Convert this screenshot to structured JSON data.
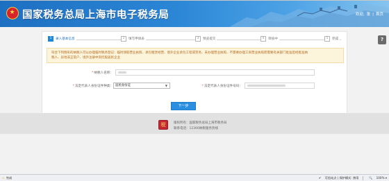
{
  "header": {
    "title": "国家税务总局上海市电子税务局",
    "welcome": "欢迎,",
    "username": "张",
    "separator": "|",
    "home_link": "首页"
  },
  "steps": [
    {
      "num": "1",
      "label": "录入基本信息",
      "active": true
    },
    {
      "num": "2",
      "label": "填写申请表",
      "active": false
    },
    {
      "num": "3",
      "label": "预览提交",
      "active": false
    },
    {
      "num": "4",
      "label": "审核中",
      "active": false
    },
    {
      "num": "5",
      "label": "完成",
      "active": false
    }
  ],
  "notice": {
    "line1": "符合下列情形的纳税人可以办理临时税务登记：临时领取营业执照、承包租赁经营、境外企业承包工程或劳务、未办理营业执照、不需要办理工商营业执照而需要有关部门批准后经批准纳",
    "line2": "税人、异地非正常户、境外注册中资控股居民企业"
  },
  "form": {
    "taxpayer_name_label": "纳税人名称：",
    "legal_id_type_label": "法定代表人身份证件种类：",
    "legal_id_type_value": "居民身份证",
    "legal_id_no_label": "法定代表人身份证件号码："
  },
  "next_button": "下一步",
  "footer": {
    "copyright": "版权所有：国家税务总局上海市税务局",
    "phone": "联系电话：12366纳税服务热线"
  },
  "help_icon_text": "?",
  "statusbar": {
    "left_text": "完成",
    "trusted": "可信站点 | 保护模式: 禁用",
    "zoom": "100%"
  },
  "colors": {
    "header_blue": "#1e6fc1",
    "accent": "#2b8fe0",
    "notice_bg": "#fdf4dc"
  }
}
